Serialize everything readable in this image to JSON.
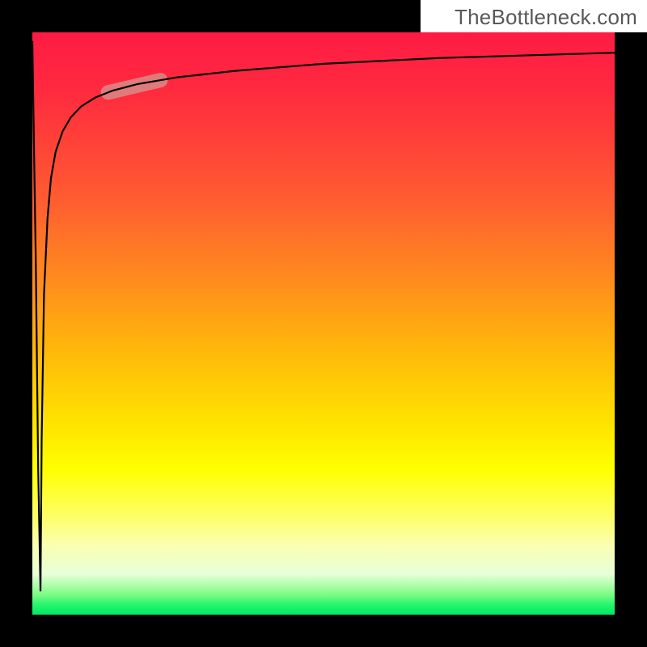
{
  "watermark": "TheBottleneck.com",
  "colors": {
    "border": "#000000",
    "highlight": "#d88d87",
    "gradient_top": "#ff1b44",
    "gradient_mid": "#ffff00",
    "gradient_bottom": "#04e765"
  },
  "chart_data": {
    "type": "line",
    "title": "",
    "xlabel": "",
    "ylabel": "",
    "xlim": [
      0,
      100
    ],
    "ylim": [
      0,
      100
    ],
    "grid": false,
    "legend": false,
    "background": "vertical-gradient red→yellow→green",
    "series": [
      {
        "name": "curve",
        "x": [
          0.0,
          0.6,
          1.0,
          1.4,
          1.4,
          1.6,
          2.0,
          2.6,
          3.2,
          4.0,
          5.2,
          6.6,
          8.4,
          10.8,
          13.8,
          18.0,
          25.0,
          35.0,
          50.0,
          70.0,
          100.0
        ],
        "y": [
          98.5,
          60.0,
          25.0,
          4.0,
          4.0,
          30.0,
          55.0,
          68.0,
          75.0,
          79.5,
          83.0,
          85.4,
          87.3,
          88.8,
          90.0,
          91.1,
          92.3,
          93.4,
          94.6,
          95.6,
          96.5
        ]
      }
    ],
    "annotations": [
      {
        "type": "highlight-segment",
        "series": "curve",
        "x_range": [
          13.0,
          22.0
        ],
        "y_range": [
          84.0,
          87.8
        ],
        "color": "#d88d87"
      }
    ]
  }
}
